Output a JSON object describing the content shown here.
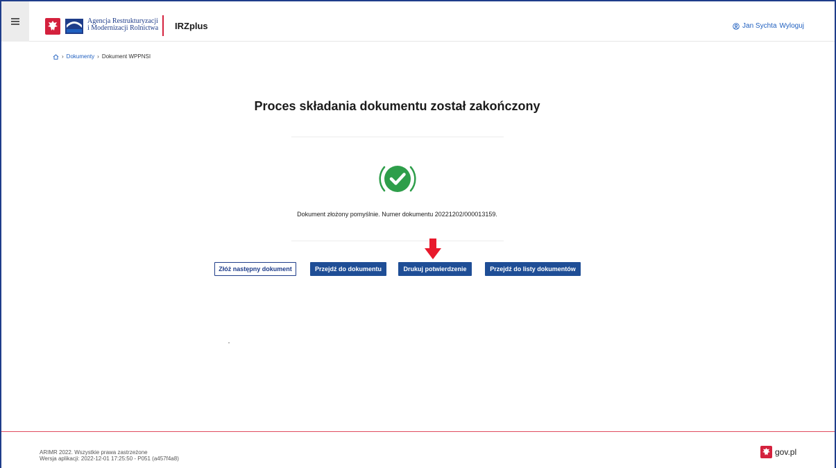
{
  "header": {
    "agency_line1": "Agencja Restrukturyzacji",
    "agency_line2": "i Modernizacji Rolnictwa",
    "app_name": "IRZplus",
    "user_name": "Jan Sychta",
    "logout_label": "Wyloguj"
  },
  "breadcrumb": {
    "items": [
      "Dokumenty",
      "Dokument WPPNSI"
    ]
  },
  "main": {
    "title": "Proces składania dokumentu został zakończony",
    "success_message": "Dokument złożony pomyślnie. Numer dokumentu 20221202/000013159.",
    "buttons": {
      "next_document": "Złóż następny dokument",
      "go_to_document": "Przejdź do dokumentu",
      "print_confirmation": "Drukuj potwierdzenie",
      "go_to_list": "Przejdź do listy dokumentów"
    }
  },
  "footer": {
    "copyright": "ARIMR 2022. Wszystkie prawa zastrzeżone",
    "version": "Wersja aplikacji: 2022-12-01 17:25:50 - P051 (a457f4a8)",
    "gov_label": "gov.pl"
  },
  "colors": {
    "primary": "#1f4e96",
    "accent_red": "#d4213d",
    "success_green": "#2e9e4a",
    "link_blue": "#1f5fbf"
  }
}
